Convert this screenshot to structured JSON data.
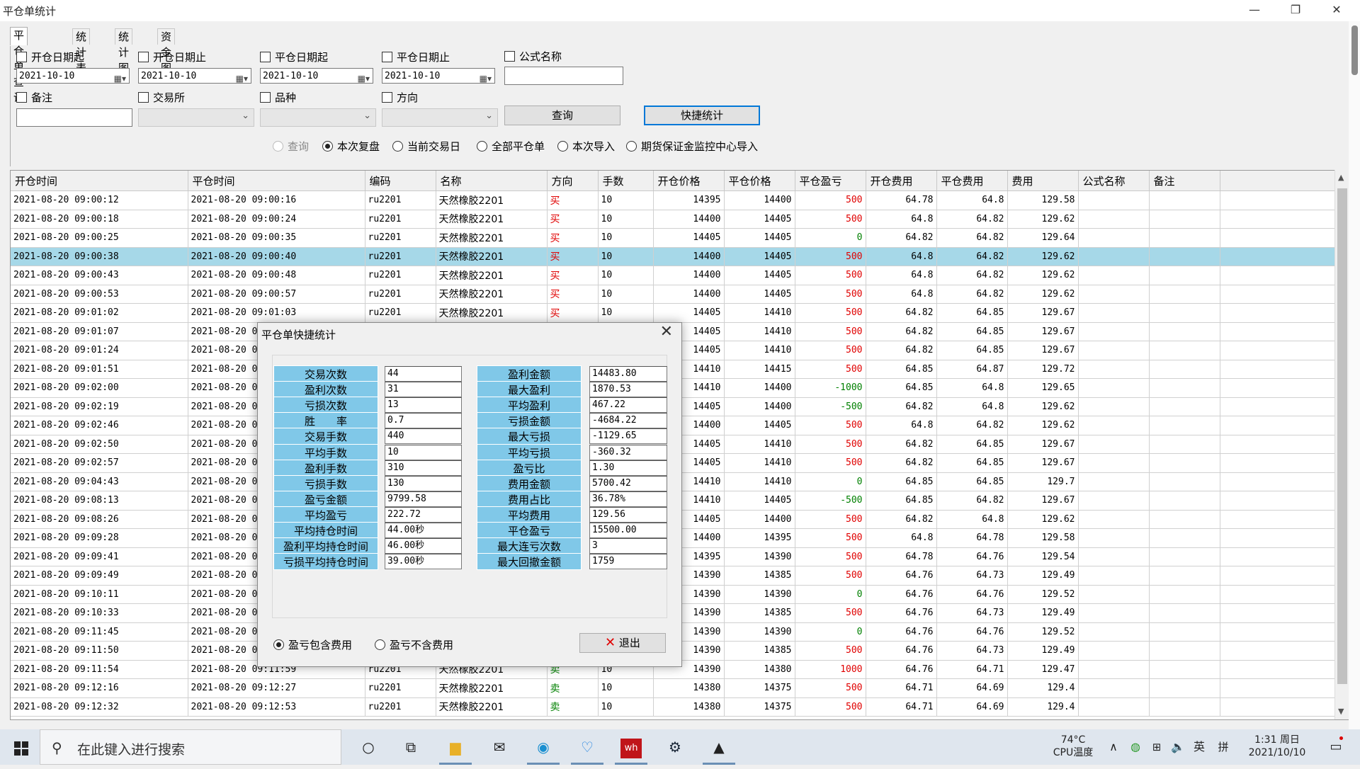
{
  "window": {
    "title": "平仓单统计",
    "minimize": "—",
    "restore": "❐",
    "close": "✕"
  },
  "tabs": [
    "平仓单查询",
    "统计表",
    "统计图",
    "资金图"
  ],
  "filters": {
    "open_from_label": "开仓日期起",
    "open_to_label": "开仓日期止",
    "close_from_label": "平仓日期起",
    "close_to_label": "平仓日期止",
    "formula_label": "公式名称",
    "date1": "2021-10-10",
    "date2": "2021-10-10",
    "date3": "2021-10-10",
    "date4": "2021-10-10",
    "note_label": "备注",
    "exchange_label": "交易所",
    "variety_label": "品种",
    "direction_label": "方向",
    "query_button": "查询",
    "quick_stats_button": "快捷统计",
    "radios": [
      "查询",
      "本次复盘",
      "当前交易日",
      "全部平仓单",
      "本次导入",
      "期货保证金监控中心导入"
    ],
    "selected_radio": 1
  },
  "grid": {
    "headers": [
      "开仓时间",
      "平仓时间",
      "编码",
      "名称",
      "方向",
      "手数",
      "开仓价格",
      "平仓价格",
      "平仓盈亏",
      "开仓费用",
      "平仓费用",
      "费用",
      "公式名称",
      "备注"
    ],
    "selected_row": 3,
    "rows": [
      [
        "2021-08-20 09:00:12",
        "2021-08-20 09:00:16",
        "ru2201",
        "天然橡胶2201",
        "买",
        "10",
        "14395",
        "14400",
        "500",
        "64.78",
        "64.8",
        "129.58"
      ],
      [
        "2021-08-20 09:00:18",
        "2021-08-20 09:00:24",
        "ru2201",
        "天然橡胶2201",
        "买",
        "10",
        "14400",
        "14405",
        "500",
        "64.8",
        "64.82",
        "129.62"
      ],
      [
        "2021-08-20 09:00:25",
        "2021-08-20 09:00:35",
        "ru2201",
        "天然橡胶2201",
        "买",
        "10",
        "14405",
        "14405",
        "0",
        "64.82",
        "64.82",
        "129.64"
      ],
      [
        "2021-08-20 09:00:38",
        "2021-08-20 09:00:40",
        "ru2201",
        "天然橡胶2201",
        "买",
        "10",
        "14400",
        "14405",
        "500",
        "64.8",
        "64.82",
        "129.62"
      ],
      [
        "2021-08-20 09:00:43",
        "2021-08-20 09:00:48",
        "ru2201",
        "天然橡胶2201",
        "买",
        "10",
        "14400",
        "14405",
        "500",
        "64.8",
        "64.82",
        "129.62"
      ],
      [
        "2021-08-20 09:00:53",
        "2021-08-20 09:00:57",
        "ru2201",
        "天然橡胶2201",
        "买",
        "10",
        "14400",
        "14405",
        "500",
        "64.8",
        "64.82",
        "129.62"
      ],
      [
        "2021-08-20 09:01:02",
        "2021-08-20 09:01:03",
        "ru2201",
        "天然橡胶2201",
        "买",
        "10",
        "14405",
        "14410",
        "500",
        "64.82",
        "64.85",
        "129.67"
      ],
      [
        "2021-08-20 09:01:07",
        "2021-08-20 09",
        "",
        "",
        "",
        "",
        "14405",
        "14410",
        "500",
        "64.82",
        "64.85",
        "129.67"
      ],
      [
        "2021-08-20 09:01:24",
        "2021-08-20 09",
        "",
        "",
        "",
        "",
        "14405",
        "14410",
        "500",
        "64.82",
        "64.85",
        "129.67"
      ],
      [
        "2021-08-20 09:01:51",
        "2021-08-20 09",
        "",
        "",
        "",
        "",
        "14410",
        "14415",
        "500",
        "64.85",
        "64.87",
        "129.72"
      ],
      [
        "2021-08-20 09:02:00",
        "2021-08-20 09",
        "",
        "",
        "",
        "",
        "14410",
        "14400",
        "-1000",
        "64.85",
        "64.8",
        "129.65"
      ],
      [
        "2021-08-20 09:02:19",
        "2021-08-20 09",
        "",
        "",
        "",
        "",
        "14405",
        "14400",
        "-500",
        "64.82",
        "64.8",
        "129.62"
      ],
      [
        "2021-08-20 09:02:46",
        "2021-08-20 09",
        "",
        "",
        "",
        "",
        "14400",
        "14405",
        "500",
        "64.8",
        "64.82",
        "129.62"
      ],
      [
        "2021-08-20 09:02:50",
        "2021-08-20 09",
        "",
        "",
        "",
        "",
        "14405",
        "14410",
        "500",
        "64.82",
        "64.85",
        "129.67"
      ],
      [
        "2021-08-20 09:02:57",
        "2021-08-20 09",
        "",
        "",
        "",
        "",
        "14405",
        "14410",
        "500",
        "64.82",
        "64.85",
        "129.67"
      ],
      [
        "2021-08-20 09:04:43",
        "2021-08-20 09",
        "",
        "",
        "",
        "",
        "14410",
        "14410",
        "0",
        "64.85",
        "64.85",
        "129.7"
      ],
      [
        "2021-08-20 09:08:13",
        "2021-08-20 09",
        "",
        "",
        "",
        "",
        "14410",
        "14405",
        "-500",
        "64.85",
        "64.82",
        "129.67"
      ],
      [
        "2021-08-20 09:08:26",
        "2021-08-20 09",
        "",
        "",
        "",
        "",
        "14405",
        "14400",
        "500",
        "64.82",
        "64.8",
        "129.62"
      ],
      [
        "2021-08-20 09:09:28",
        "2021-08-20 09",
        "",
        "",
        "",
        "",
        "14400",
        "14395",
        "500",
        "64.8",
        "64.78",
        "129.58"
      ],
      [
        "2021-08-20 09:09:41",
        "2021-08-20 09",
        "",
        "",
        "",
        "",
        "14395",
        "14390",
        "500",
        "64.78",
        "64.76",
        "129.54"
      ],
      [
        "2021-08-20 09:09:49",
        "2021-08-20 09",
        "",
        "",
        "",
        "",
        "14390",
        "14385",
        "500",
        "64.76",
        "64.73",
        "129.49"
      ],
      [
        "2021-08-20 09:10:11",
        "2021-08-20 09",
        "",
        "",
        "",
        "",
        "14390",
        "14390",
        "0",
        "64.76",
        "64.76",
        "129.52"
      ],
      [
        "2021-08-20 09:10:33",
        "2021-08-20 09",
        "",
        "",
        "",
        "",
        "14390",
        "14385",
        "500",
        "64.76",
        "64.73",
        "129.49"
      ],
      [
        "2021-08-20 09:11:45",
        "2021-08-20 09",
        "",
        "",
        "",
        "",
        "14390",
        "14390",
        "0",
        "64.76",
        "64.76",
        "129.52"
      ],
      [
        "2021-08-20 09:11:50",
        "2021-08-20 09",
        "",
        "",
        "",
        "",
        "14390",
        "14385",
        "500",
        "64.76",
        "64.73",
        "129.49"
      ],
      [
        "2021-08-20 09:11:54",
        "2021-08-20 09:11:59",
        "ru2201",
        "天然橡胶2201",
        "卖",
        "10",
        "14390",
        "14380",
        "1000",
        "64.76",
        "64.71",
        "129.47"
      ],
      [
        "2021-08-20 09:12:16",
        "2021-08-20 09:12:27",
        "ru2201",
        "天然橡胶2201",
        "卖",
        "10",
        "14380",
        "14375",
        "500",
        "64.71",
        "64.69",
        "129.4"
      ],
      [
        "2021-08-20 09:12:32",
        "2021-08-20 09:12:53",
        "ru2201",
        "天然橡胶2201",
        "卖",
        "10",
        "14380",
        "14375",
        "500",
        "64.71",
        "64.69",
        "129.4"
      ]
    ]
  },
  "dialog": {
    "title": "平仓单快捷统计",
    "close": "✕",
    "left": [
      {
        "label": "交易次数",
        "value": "44"
      },
      {
        "label": "盈利次数",
        "value": "31"
      },
      {
        "label": "亏损次数",
        "value": "13"
      },
      {
        "label": "胜　　率",
        "value": "0.7"
      },
      {
        "label": "交易手数",
        "value": "440"
      },
      {
        "label": "平均手数",
        "value": "10"
      },
      {
        "label": "盈利手数",
        "value": "310"
      },
      {
        "label": "亏损手数",
        "value": "130"
      },
      {
        "label": "盈亏金额",
        "value": "9799.58"
      },
      {
        "label": "平均盈亏",
        "value": "222.72"
      },
      {
        "label": "平均持仓时间",
        "value": "44.00秒"
      },
      {
        "label": "盈利平均持仓时间",
        "value": "46.00秒"
      },
      {
        "label": "亏损平均持仓时间",
        "value": "39.00秒"
      }
    ],
    "right": [
      {
        "label": "盈利金额",
        "value": "14483.80"
      },
      {
        "label": "最大盈利",
        "value": "1870.53"
      },
      {
        "label": "平均盈利",
        "value": "467.22"
      },
      {
        "label": "亏损金额",
        "value": "-4684.22"
      },
      {
        "label": "最大亏损",
        "value": "-1129.65"
      },
      {
        "label": "平均亏损",
        "value": "-360.32"
      },
      {
        "label": "盈亏比",
        "value": "1.30"
      },
      {
        "label": "费用金额",
        "value": "5700.42"
      },
      {
        "label": "费用占比",
        "value": "36.78%"
      },
      {
        "label": "平均费用",
        "value": "129.56"
      },
      {
        "label": "平仓盈亏",
        "value": "15500.00"
      },
      {
        "label": "最大连亏次数",
        "value": "3"
      },
      {
        "label": "最大回撤金额",
        "value": "1759"
      }
    ],
    "radio_include_fee": "盈亏包含费用",
    "radio_exclude_fee": "盈亏不含费用",
    "exit_button": "退出"
  },
  "taskbar": {
    "search_placeholder": "在此键入进行搜索",
    "temp": "74°C",
    "temp_label": "CPU温度",
    "ime": "英",
    "ime2": "拼",
    "time": "1:31 周日",
    "date": "2021/10/10"
  }
}
